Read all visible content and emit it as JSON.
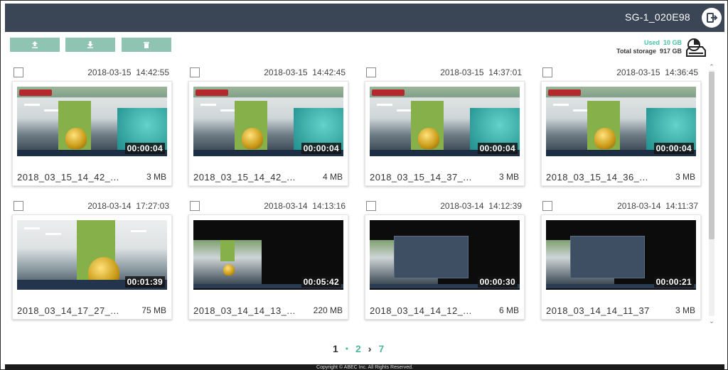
{
  "header": {
    "device_name": "SG-1_020E98",
    "logout_icon": "logout-icon"
  },
  "toolbar": {
    "buttons": [
      {
        "name": "upload",
        "icon": "upload-icon"
      },
      {
        "name": "download",
        "icon": "download-icon"
      },
      {
        "name": "delete",
        "icon": "trash-icon"
      }
    ]
  },
  "storage": {
    "used_label": "Used",
    "used_value": "10 GB",
    "total_label": "Total storage",
    "total_value": "917 GB",
    "icon": "hard-drive-icon"
  },
  "recordings": [
    {
      "date": "2018-03-15",
      "time": "14:42:55",
      "duration": "00:00:04",
      "filename": "2018_03_15_14_42_...",
      "size": "3 MB"
    },
    {
      "date": "2018-03-15",
      "time": "14:42:45",
      "duration": "00:00:04",
      "filename": "2018_03_15_14_42_...",
      "size": "4 MB"
    },
    {
      "date": "2018-03-15",
      "time": "14:37:01",
      "duration": "00:00:04",
      "filename": "2018_03_15_14_37_...",
      "size": "3 MB"
    },
    {
      "date": "2018-03-15",
      "time": "14:36:45",
      "duration": "00:00:04",
      "filename": "2018_03_15_14_36_...",
      "size": "3 MB"
    },
    {
      "date": "2018-03-14",
      "time": "17:27:03",
      "duration": "00:01:39",
      "filename": "2018_03_14_17_27_...",
      "size": "75 MB"
    },
    {
      "date": "2018-03-14",
      "time": "14:13:16",
      "duration": "00:05:42",
      "filename": "2018_03_14_14_13_...",
      "size": "220 MB"
    },
    {
      "date": "2018-03-14",
      "time": "14:12:39",
      "duration": "00:00:30",
      "filename": "2018_03_14_14_12_...",
      "size": "6 MB"
    },
    {
      "date": "2018-03-14",
      "time": "14:11:37",
      "duration": "00:00:21",
      "filename": "2018_03_14_14_11_37",
      "size": "3 MB"
    }
  ],
  "pagination": {
    "current": "1",
    "separator": "•",
    "next_page": "2",
    "next_arrow": "›",
    "last_page": "7"
  },
  "footer": {
    "copyright": "Copyright © ABEC Inc. All Rights Reserved."
  },
  "colors": {
    "header_bg": "#3a4556",
    "accent": "#4fb69d",
    "toolbar_button": "#8fc4b2"
  }
}
